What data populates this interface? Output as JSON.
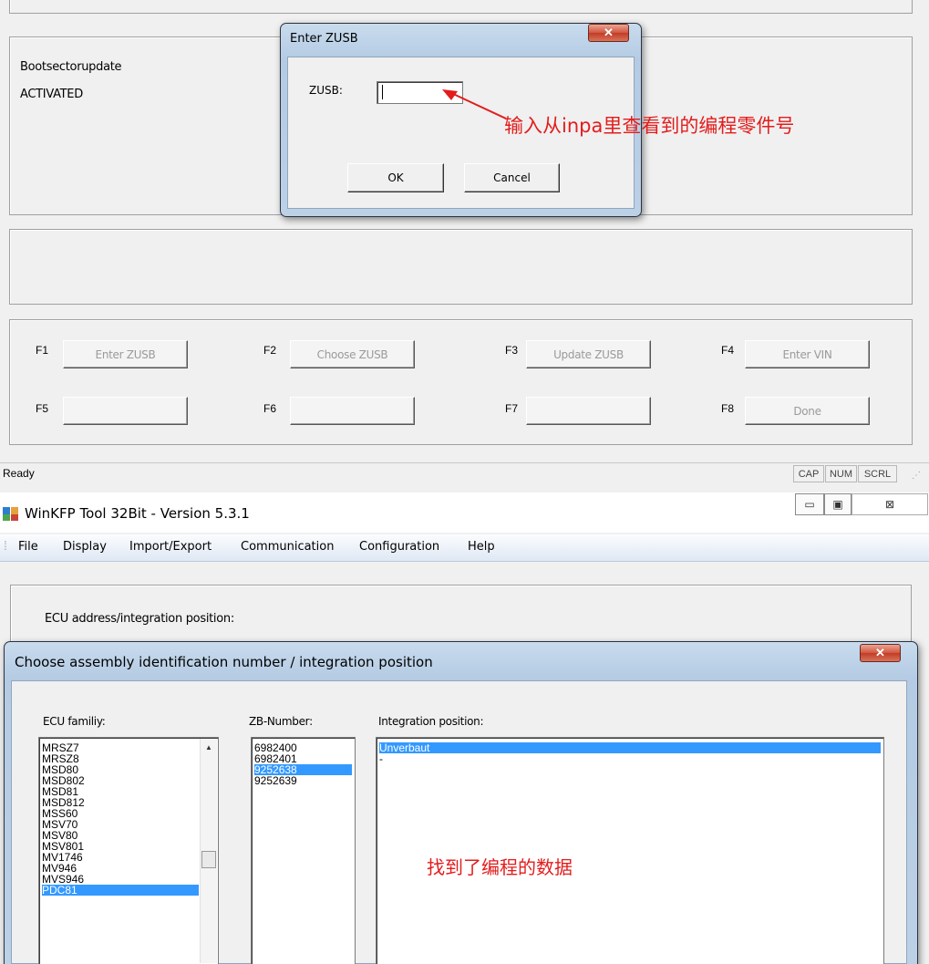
{
  "top": {
    "bootsector_label": "Bootsectorupdate",
    "bootsector_value": "ACTIVATED",
    "fkeys": [
      {
        "key": "F1",
        "label": "Enter ZUSB"
      },
      {
        "key": "F2",
        "label": "Choose ZUSB"
      },
      {
        "key": "F3",
        "label": "Update ZUSB"
      },
      {
        "key": "F4",
        "label": "Enter VIN"
      },
      {
        "key": "F5",
        "label": ""
      },
      {
        "key": "F6",
        "label": ""
      },
      {
        "key": "F7",
        "label": ""
      },
      {
        "key": "F8",
        "label": "Done"
      }
    ],
    "status_text": "Ready",
    "status_indicators": [
      "CAP",
      "NUM",
      "SCRL"
    ]
  },
  "zusb_dialog": {
    "title": "Enter ZUSB",
    "field_label": "ZUSB:",
    "field_value": "",
    "ok_label": "OK",
    "cancel_label": "Cancel",
    "annotation": "输入从inpa里查看到的编程零件号"
  },
  "main_window": {
    "title": "WinKFP Tool 32Bit - Version 5.3.1",
    "menu": [
      "File",
      "Display",
      "Import/Export",
      "Communication",
      "Configuration",
      "Help"
    ],
    "ecu_address_label": "ECU address/integration position:"
  },
  "assembly_dialog": {
    "title": "Choose assembly identification number / integration position",
    "ecu_family_header": "ECU familiy:",
    "ecu_family_items": [
      "MRSZ7",
      "MRSZ8",
      "MSD80",
      "MSD802",
      "MSD81",
      "MSD812",
      "MSS60",
      "MSV70",
      "MSV80",
      "MSV801",
      "MV1746",
      "MV946",
      "MVS946",
      "PDC81"
    ],
    "ecu_family_selected": "PDC81",
    "zb_header": "ZB-Number:",
    "zb_items": [
      "6982400",
      "6982401",
      "9252638",
      "9252639"
    ],
    "zb_selected": "9252638",
    "integration_header": "Integration position:",
    "integration_items": [
      "Unverbaut",
      "-"
    ],
    "integration_selected": "Unverbaut",
    "annotation": "找到了编程的数据"
  },
  "colors": {
    "selection": "#3399ff",
    "annotation_red": "#e31c1c"
  }
}
